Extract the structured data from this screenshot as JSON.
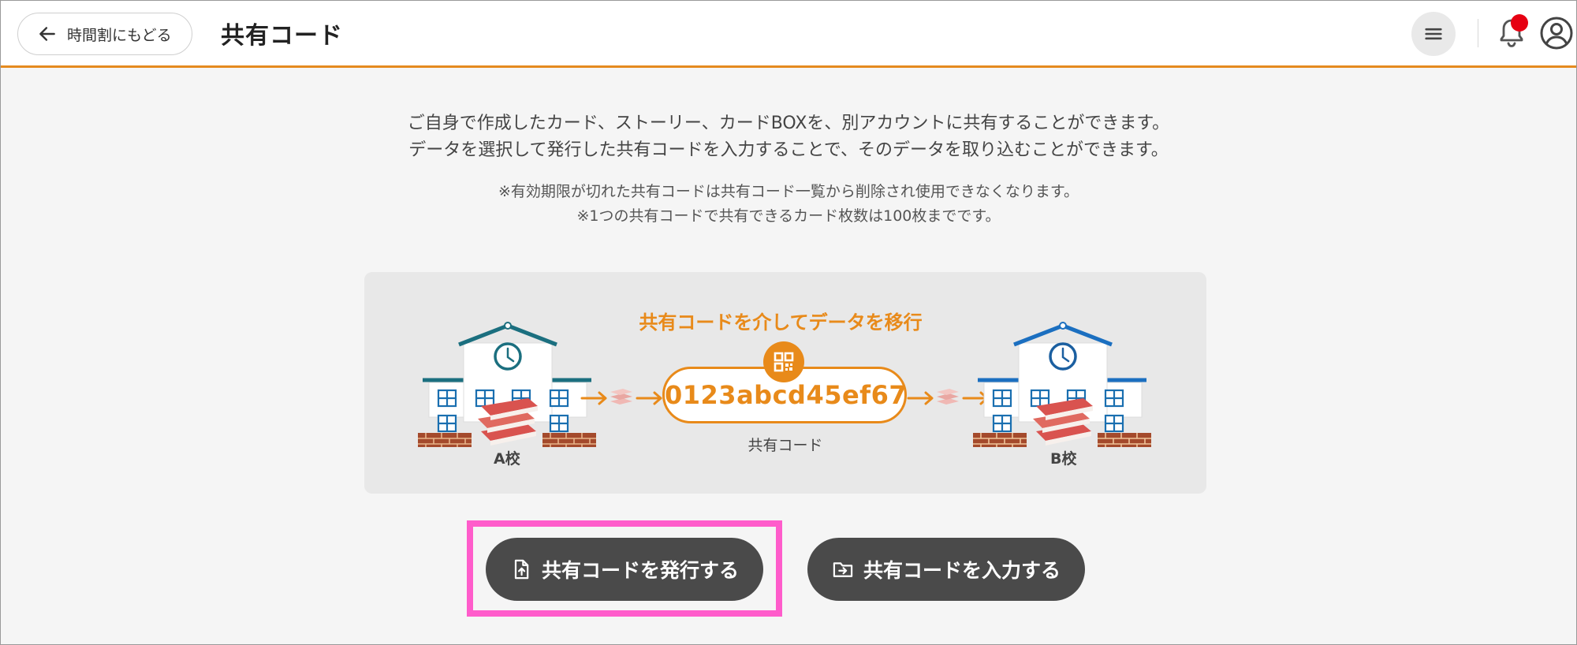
{
  "header": {
    "back_label": "時間割にもどる",
    "title": "共有コード",
    "icons": [
      "arrow-left-icon",
      "menu-icon",
      "bell-icon",
      "user-icon"
    ],
    "accent_color": "#e58a1f",
    "notification_dot_color": "#e60012"
  },
  "description": {
    "line1": "ご自身で作成したカード、ストーリー、カードBOXを、別アカウントに共有することができます。",
    "line2": "データを選択して発行した共有コードを入力することで、そのデータを取り込むことができます。"
  },
  "notes": {
    "line1": "※有効期限が切れた共有コードは共有コード一覧から削除され使用できなくなります。",
    "line2": "※1つの共有コードで共有できるカード枚数は100枚までです。"
  },
  "illustration": {
    "title": "共有コードを介してデータを移行",
    "code": "0123abcd45ef67",
    "code_label": "共有コード",
    "school_a": "A校",
    "school_b": "B校",
    "accent_color": "#e88a1a"
  },
  "actions": {
    "issue_label": "共有コードを発行する",
    "enter_label": "共有コードを入力する",
    "highlight_color": "#ff5ccb"
  }
}
